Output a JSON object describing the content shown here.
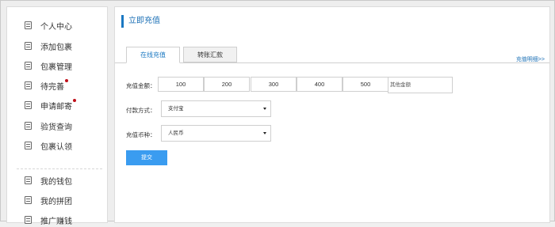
{
  "sidebar": {
    "items": [
      {
        "label": "个人中心",
        "icon": "list-icon",
        "badge": false
      },
      {
        "label": "添加包裹",
        "icon": "list-icon",
        "badge": false
      },
      {
        "label": "包裹管理",
        "icon": "list-icon",
        "badge": false
      },
      {
        "label": "待完善",
        "icon": "list-icon",
        "badge": true
      },
      {
        "label": "申请邮寄",
        "icon": "list-icon",
        "badge": true
      },
      {
        "label": "验货查询",
        "icon": "list-icon",
        "badge": false
      },
      {
        "label": "包裹认领",
        "icon": "list-icon",
        "badge": false
      },
      {
        "label": "我的钱包",
        "icon": "list-icon",
        "badge": false
      },
      {
        "label": "我的拼团",
        "icon": "list-icon",
        "badge": false
      },
      {
        "label": "推广赚钱",
        "icon": "list-icon",
        "badge": false
      }
    ]
  },
  "main": {
    "title": "立即充值",
    "tabs": [
      {
        "label": "在线充值",
        "active": true
      },
      {
        "label": "转账汇款",
        "active": false
      }
    ],
    "help_link": "充值明细>>",
    "amount_label": "充值金额：",
    "amounts": [
      "100",
      "200",
      "300",
      "400",
      "500"
    ],
    "other_amount_placeholder": "其他金额",
    "payment_label": "付款方式：",
    "payment_value": "支付宝",
    "currency_label": "充值币种：",
    "currency_value": "人民币",
    "submit_label": "提交"
  },
  "colors": {
    "accent": "#1a78c2",
    "button": "#3a9cf0",
    "badge": "#c0101a"
  }
}
